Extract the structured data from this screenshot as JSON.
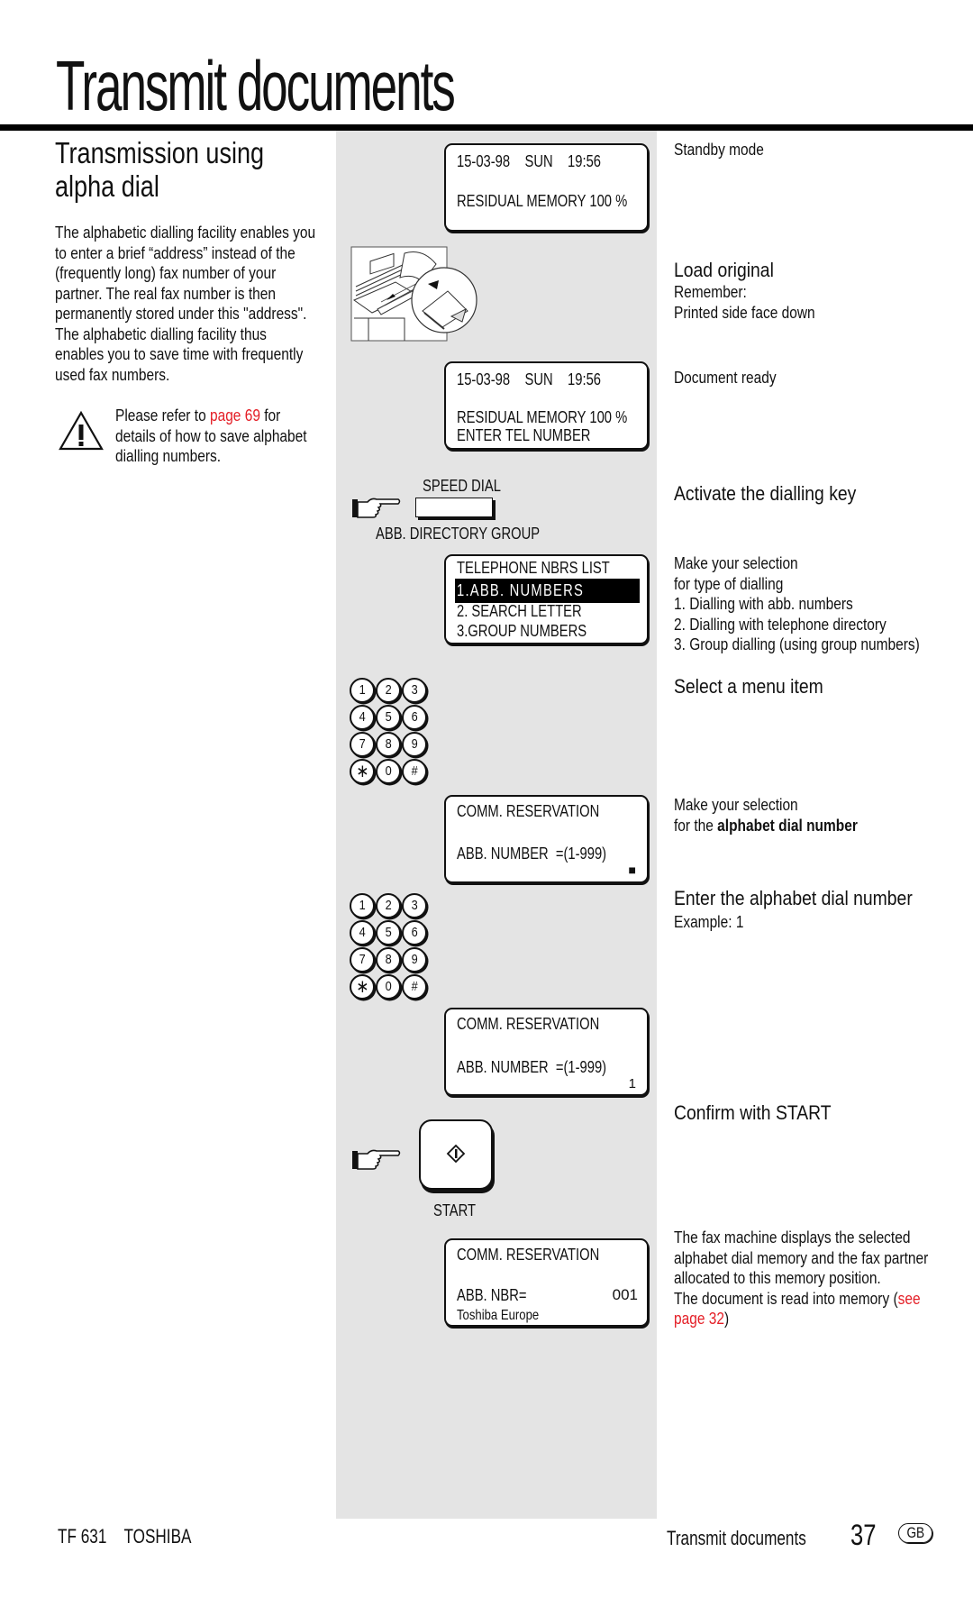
{
  "page": {
    "title": "Transmit documents",
    "section_title_line1": "Transmission using",
    "section_title_line2": "alpha dial"
  },
  "intro": {
    "lines": [
      "The alphabetic dialling facility enables you",
      "to enter a brief “address” instead of the",
      "(frequently long) fax number of your",
      "partner. The real fax number is then",
      "permanently stored under this \"address\".",
      "The alphabetic dialling facility thus",
      "enables you to save time with frequently",
      "used fax numbers."
    ]
  },
  "warning": {
    "icon": "warning-triangle-icon",
    "line1_prefix": "Please refer to ",
    "line1_link": "page 69",
    "line1_suffix": " for",
    "line2": "details of how to save alphabet",
    "line3": "dialling numbers."
  },
  "displays": [
    {
      "lines": [
        "15-03-98    SUN    19:56",
        "RESIDUAL MEMORY 100 %"
      ]
    },
    {
      "lines": [
        "15-03-98    SUN    19:56",
        "RESIDUAL MEMORY 100 %",
        "ENTER TEL NUMBER"
      ]
    },
    {
      "lines": [
        "TELEPHONE NBRS LIST",
        "1.ABB. NUMBERS",
        "2. SEARCH LETTER",
        "3.GROUP NUMBERS"
      ],
      "highlighted_index": 1
    },
    {
      "lines": [
        "COMM. RESERVATION",
        "ABB. NUMBER  =(1-999)"
      ],
      "cursor": "■"
    },
    {
      "lines": [
        "COMM. RESERVATION",
        "ABB. NUMBER  =(1-999)"
      ],
      "input_value": "1"
    },
    {
      "lines": [
        "COMM. RESERVATION",
        "ABB. NBR=",
        "Toshiba Europe"
      ],
      "value": "001"
    }
  ],
  "controls": {
    "speed_dial_label": "SPEED DIAL",
    "speed_dial_sublabel": "ABB. DIRECTORY GROUP",
    "start_label": "START",
    "keypad_keys": [
      "1",
      "2",
      "3",
      "4",
      "5",
      "6",
      "7",
      "8",
      "9",
      "∗",
      "0",
      "#"
    ]
  },
  "steps": {
    "standby": "Standby mode",
    "load_original": "Load original",
    "load_remember": "Remember:",
    "load_face": "Printed side face down",
    "document_ready": "Document ready",
    "activate": "Activate the dialling key",
    "selection_lines": [
      "Make your selection",
      "for type of dialling",
      "1. Dialling with abb. numbers",
      "2. Dialling with telephone directory",
      "3. Group dialling (using group numbers)"
    ],
    "select_menu": "Select a menu item",
    "alpha_sel_line1": "Make your selection",
    "alpha_sel_prefix": "for the ",
    "alpha_sel_bold": "alphabet dial number",
    "enter_alpha": "Enter the alphabet dial number",
    "example": "Example: 1",
    "confirm": "Confirm with START",
    "result_lines": [
      "The fax machine displays the selected",
      "alphabet dial memory and the fax partner",
      "allocated to this memory position."
    ],
    "result_last_prefix": "The document is read into memory (",
    "result_link_1": "see",
    "result_link_2": "page 32",
    "result_last_suffix": ")"
  },
  "footer": {
    "model": "TF 631",
    "brand": "TOSHIBA",
    "section": "Transmit documents",
    "page_number": "37",
    "language_badge": "GB"
  },
  "colors": {
    "link_red": "#e41e26",
    "panel_gray": "#e4e4e4"
  }
}
